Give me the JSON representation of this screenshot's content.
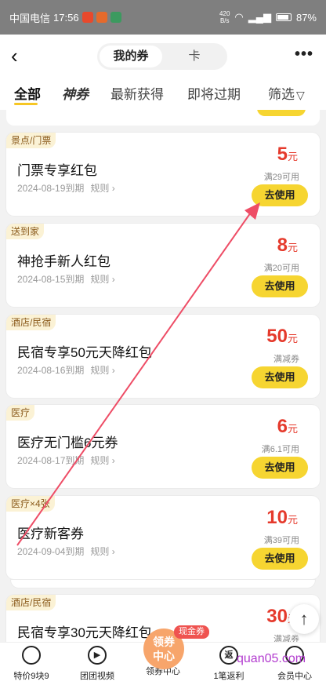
{
  "status_bar": {
    "carrier": "中国电信",
    "time": "17:56",
    "net_speed": "420",
    "net_unit": "B/s",
    "battery": "87%"
  },
  "header": {
    "segments": [
      "我的券",
      "卡"
    ],
    "active_segment": "我的券",
    "more": "•••"
  },
  "tabs": [
    "全部",
    "神券",
    "最新获得",
    "即将过期",
    "筛选"
  ],
  "coupons": [
    {
      "tag": "景点/门票",
      "title": "门票专享红包",
      "expiry": "2024-08-19到期",
      "rule": "规则",
      "amount": "5",
      "unit": "元",
      "condition": "满29可用",
      "button": "去使用"
    },
    {
      "tag": "送到家",
      "title": "神抢手新人红包",
      "expiry": "2024-08-15到期",
      "rule": "规则",
      "amount": "8",
      "unit": "元",
      "condition": "满20可用",
      "button": "去使用"
    },
    {
      "tag": "酒店/民宿",
      "title": "民宿专享50元天降红包",
      "expiry": "2024-08-16到期",
      "rule": "规则",
      "amount": "50",
      "unit": "元",
      "condition": "满减券",
      "button": "去使用"
    },
    {
      "tag": "医疗",
      "title": "医疗无门槛6元券",
      "expiry": "2024-08-17到期",
      "rule": "规则",
      "amount": "6",
      "unit": "元",
      "condition": "满6.1可用",
      "button": "去使用"
    },
    {
      "tag": "医疗×4张",
      "title": "医疗新客券",
      "expiry": "2024-09-04到期",
      "rule": "规则",
      "amount": "10",
      "unit": "元",
      "condition": "满39可用",
      "button": "去使用"
    },
    {
      "tag": "酒店/民宿",
      "title": "民宿专享30元天降红包",
      "amount": "30",
      "unit": "元",
      "condition": "满减券"
    }
  ],
  "bottom_nav": {
    "items": [
      "特价9块9",
      "团团视频",
      "领券中心",
      "1笔返利",
      "会员中心"
    ],
    "center_line1": "领券",
    "center_line2": "中心",
    "cash_badge": "现金券",
    "rebate_icon_char": "返"
  },
  "watermark": "quan05.com",
  "colors": {
    "accent_yellow": "#f6d531",
    "price_red": "#e53a2c",
    "annotation_arrow": "#ee4d66"
  }
}
